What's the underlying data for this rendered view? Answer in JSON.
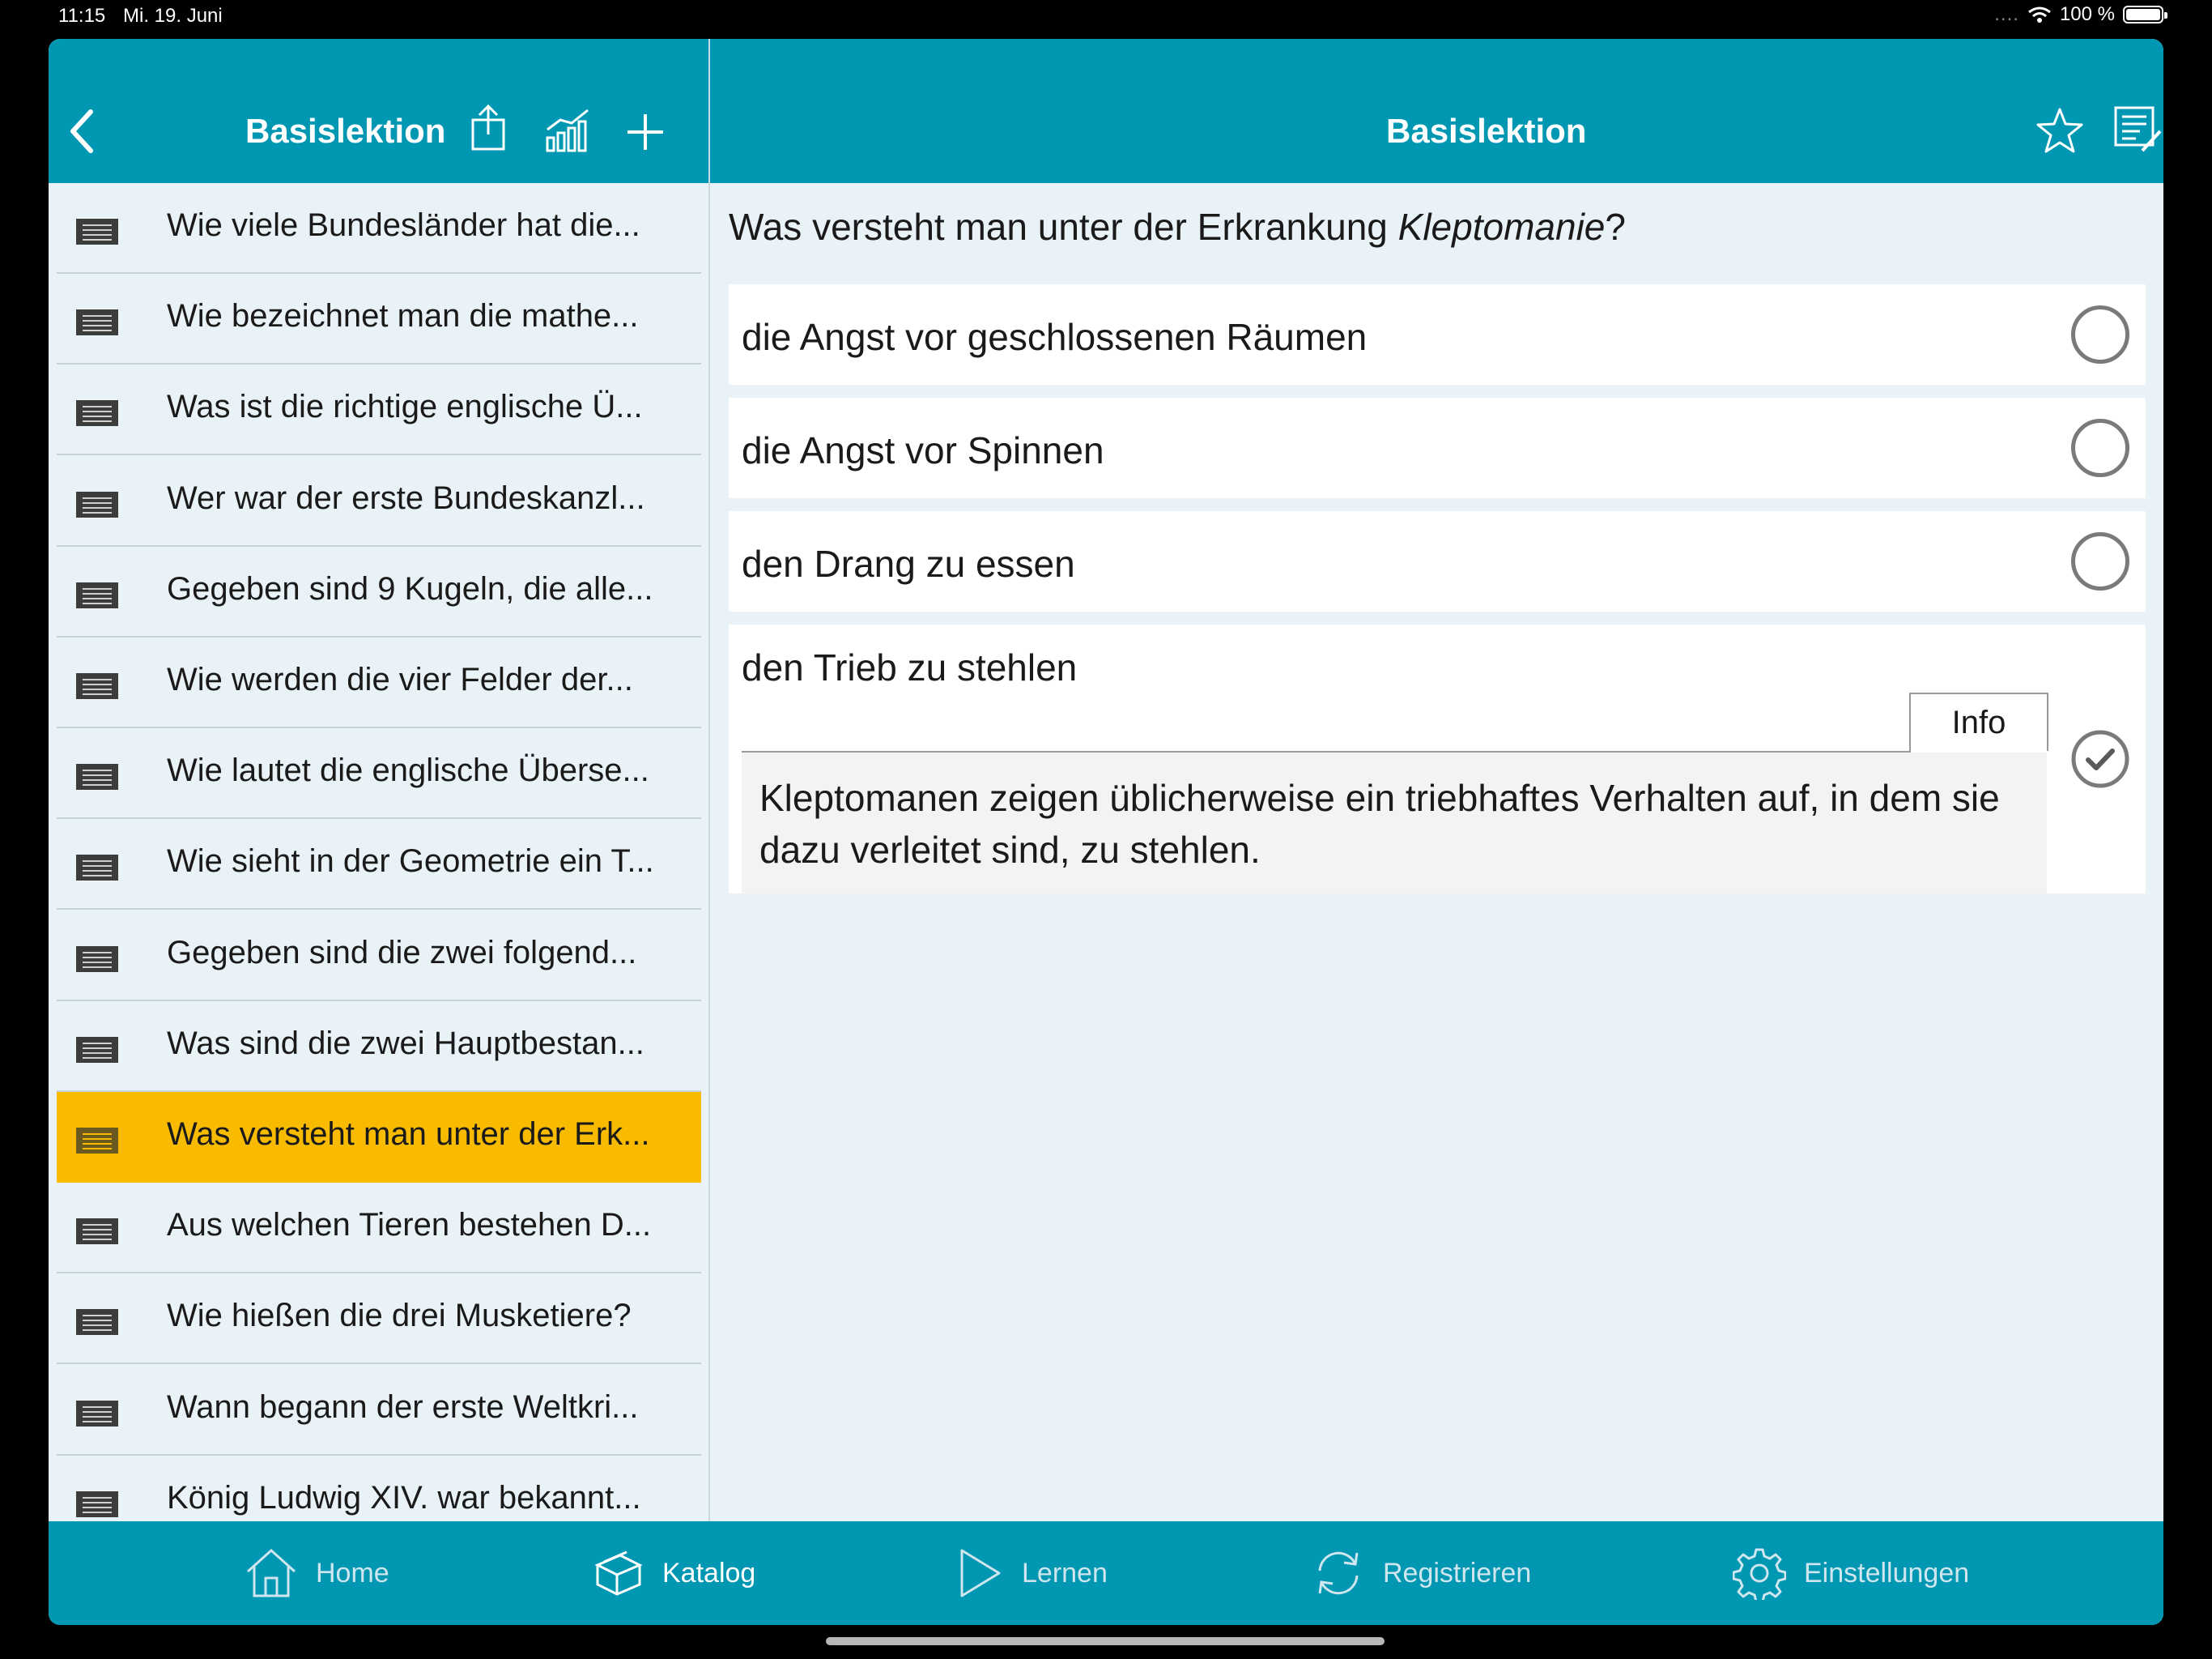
{
  "status_bar": {
    "time": "11:15",
    "date": "Mi. 19. Juni",
    "battery": "100 %",
    "signal_dots": "....",
    "icons": [
      "wifi-icon",
      "battery-icon"
    ]
  },
  "left_header": {
    "title": "Basislektion",
    "icons": [
      "back-chevron-icon",
      "share-icon",
      "statistics-icon",
      "plus-icon"
    ]
  },
  "right_header": {
    "title": "Basislektion",
    "icons": [
      "star-icon",
      "edit-note-icon"
    ]
  },
  "list": {
    "items": [
      {
        "label": "Wie viele Bundesländer hat die..."
      },
      {
        "label": "Wie bezeichnet man die mathe..."
      },
      {
        "label": "Was ist die richtige englische Ü..."
      },
      {
        "label": "Wer war der erste Bundeskanzl..."
      },
      {
        "label": "Gegeben sind 9 Kugeln, die alle..."
      },
      {
        "label": "Wie werden die vier Felder der..."
      },
      {
        "label": "Wie lautet die englische Überse..."
      },
      {
        "label": "Wie sieht in der Geometrie ein T..."
      },
      {
        "label": "Gegeben sind die zwei folgend..."
      },
      {
        "label": "Was sind die zwei Hauptbestan..."
      },
      {
        "label": "Was versteht man unter der Erk...",
        "active": true
      },
      {
        "label": "Aus welchen Tieren bestehen D..."
      },
      {
        "label": "Wie hießen die drei Musketiere?"
      },
      {
        "label": "Wann begann der erste Weltkri..."
      },
      {
        "label": "König Ludwig XIV. war bekannt..."
      }
    ]
  },
  "question": {
    "prefix": "Was versteht man unter der Erkrankung ",
    "term": "Kleptomanie",
    "suffix": "?"
  },
  "answers": [
    {
      "text": "die Angst vor geschlossenen Räumen",
      "selected": false
    },
    {
      "text": "die Angst vor Spinnen",
      "selected": false
    },
    {
      "text": "den Drang zu essen",
      "selected": false
    },
    {
      "text": "den Trieb zu stehlen",
      "selected": true
    }
  ],
  "info": {
    "tab_label": "Info",
    "text": "Kleptomanen zeigen üblicherweise ein triebhaftes Verhalten auf, in dem sie dazu verleitet sind, zu stehlen."
  },
  "tab_bar": {
    "tabs": [
      {
        "label": "Home",
        "icon": "home-icon"
      },
      {
        "label": "Katalog",
        "icon": "catalog-icon",
        "active": true
      },
      {
        "label": "Lernen",
        "icon": "play-icon"
      },
      {
        "label": "Registrieren",
        "icon": "sync-icon"
      },
      {
        "label": "Einstellungen",
        "icon": "gear-icon"
      }
    ]
  },
  "colors": {
    "header": "#0097b2",
    "active_item": "#f8bb00",
    "content_bg": "#e8f2f7"
  }
}
